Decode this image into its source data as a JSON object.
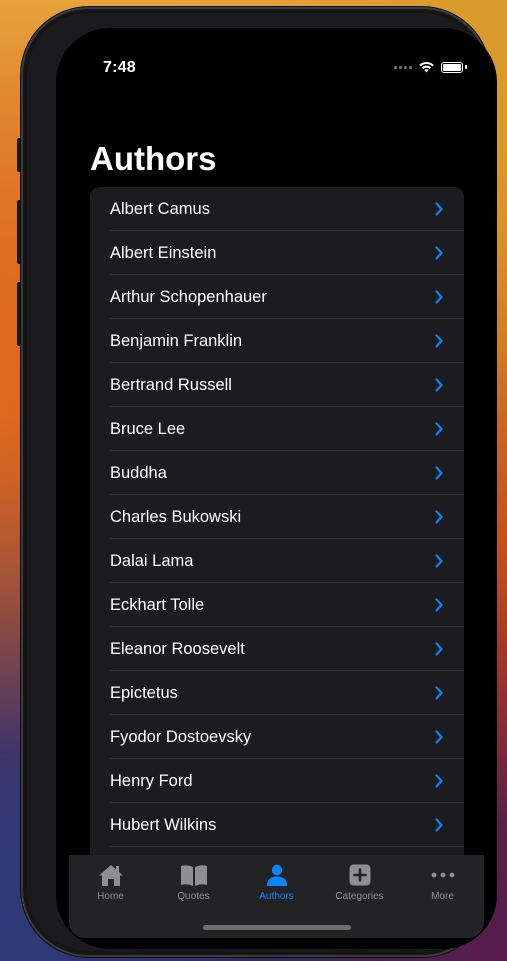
{
  "status_bar": {
    "time": "7:48"
  },
  "nav": {
    "title": "Authors"
  },
  "authors": [
    "Albert Camus",
    "Albert Einstein",
    "Arthur Schopenhauer",
    "Benjamin Franklin",
    "Bertrand Russell",
    "Bruce Lee",
    "Buddha",
    "Charles Bukowski",
    "Dalai Lama",
    "Eckhart Tolle",
    "Eleanor Roosevelt",
    "Epictetus",
    "Fyodor Dostoevsky",
    "Henry Ford",
    "Hubert Wilkins",
    ""
  ],
  "tab_bar": {
    "tabs": [
      {
        "label": "Home",
        "icon": "house-icon",
        "active": false
      },
      {
        "label": "Quotes",
        "icon": "book-icon",
        "active": false
      },
      {
        "label": "Authors",
        "icon": "person-icon",
        "active": true
      },
      {
        "label": "Categories",
        "icon": "plus-square-icon",
        "active": false
      },
      {
        "label": "More",
        "icon": "ellipsis-icon",
        "active": false
      }
    ]
  },
  "colors": {
    "accent": "#0a84ff",
    "inactive": "#8e8e93",
    "list_background": "#1c1c1e",
    "screen_background": "#000000"
  }
}
